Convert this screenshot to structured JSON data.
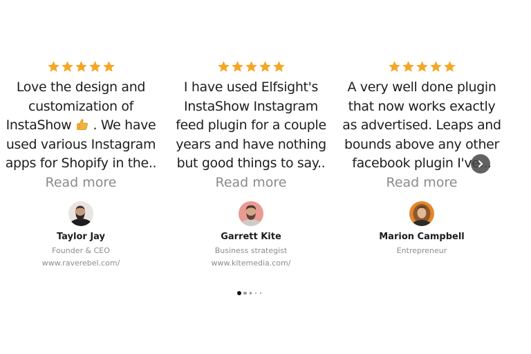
{
  "testimonials": [
    {
      "rating_stars": 5,
      "quote_lines": [
        "Love the design and",
        "customization of",
        "InstaShow",
        ". We have",
        "used various Instagram",
        "apps for Shopify in the.."
      ],
      "read_more": "Read more",
      "name": "Taylor Jay",
      "role": "Founder & CEO",
      "website": "www.raverebel.com/",
      "avatar_icon": "bald-bearded-man-avatar"
    },
    {
      "rating_stars": 5,
      "quote_lines": [
        "I have used Elfsight's",
        "InstaShow Instagram",
        "feed plugin for a couple",
        "years and have nothing",
        "but good things to say.."
      ],
      "read_more": "Read more",
      "name": "Garrett Kite",
      "role": "Business strategist",
      "website": "www.kitemedia.com/",
      "avatar_icon": "bearded-man-avatar"
    },
    {
      "rating_stars": 5,
      "quote_lines": [
        "A very well done plugin",
        "that now works exactly",
        "as advertised. Leaps and",
        "bounds above any other",
        "facebook plugin I've..."
      ],
      "read_more": "Read more",
      "name": "Marion Campbell",
      "role": "Entrepreneur",
      "website": "",
      "avatar_icon": "curly-hair-woman-avatar"
    }
  ],
  "icons": {
    "star": "star-icon",
    "thumbs_up": "thumbs-up-emoji",
    "next": "chevron-right-icon"
  },
  "pagination": {
    "total": 5,
    "active_index": 0
  },
  "colors": {
    "star": "#f5a623",
    "text": "#1d1d1d",
    "muted": "#8a8a8a",
    "nav_button": "#464646"
  }
}
